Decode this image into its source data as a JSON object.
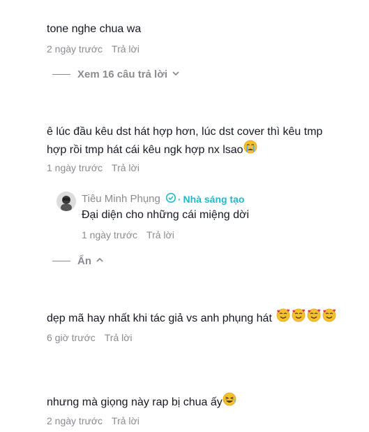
{
  "comments": [
    {
      "text": "tone nghe chua wa",
      "time": "2 ngày trước",
      "reply": "Trả lời",
      "toggle": "Xem 16 câu trả lời"
    },
    {
      "text_line1": "ê lúc đầu kêu dst hát hợp hơn, lúc dst cover thì kêu tmp",
      "text_line2": "hợp rồi tmp hát cái kêu ngk hợp nx lsao",
      "emoji": "crying-face",
      "time": "1 ngày trước",
      "reply": "Trả lời",
      "subreply": {
        "author": "Tiêu Minh Phụng",
        "badge_label": "Nhà sáng tạo",
        "badge_color": "#20b8c8",
        "text": "Đại diện cho những cái miệng dời",
        "time": "1 ngày trước",
        "reply": "Trả lời"
      },
      "toggle": "Ẩn"
    },
    {
      "text": "dẹp mã hay nhất khi tác giả vs anh phụng hát",
      "emoji": "smiling-face-with-hearts",
      "emoji_count": 4,
      "time": "6 giờ trước",
      "reply": "Trả lời"
    },
    {
      "text": "nhưng mà giọng này rap bị chua ấy",
      "emoji": "laughing-face",
      "time": "2 ngày trước",
      "reply": "Trả lời"
    }
  ],
  "colors": {
    "text": "#161823",
    "muted": "#8a8b91",
    "accent": "#20b8c8"
  }
}
